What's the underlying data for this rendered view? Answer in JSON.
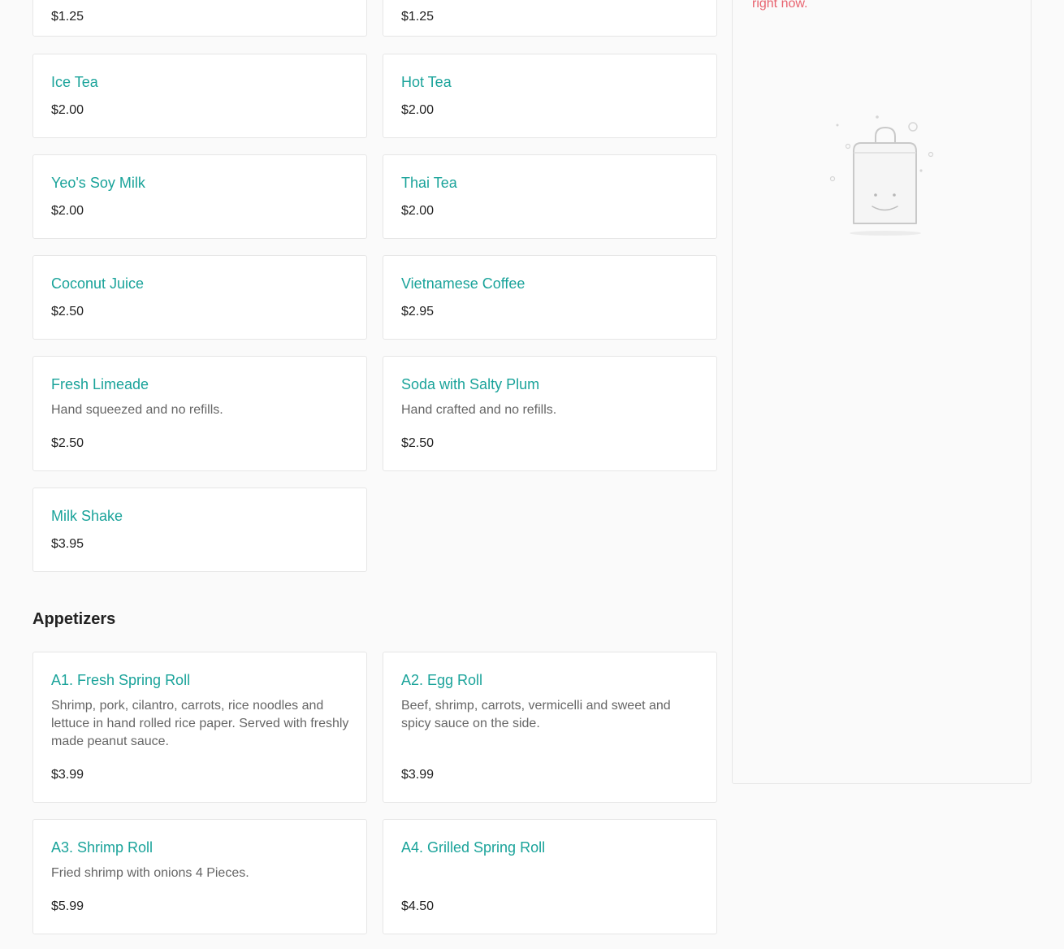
{
  "cart": {
    "empty_message": "right now."
  },
  "drinks": {
    "items": [
      {
        "price": "$1.25"
      },
      {
        "price": "$1.25"
      },
      {
        "name": "Ice Tea",
        "price": "$2.00"
      },
      {
        "name": "Hot Tea",
        "price": "$2.00"
      },
      {
        "name": "Yeo's Soy Milk",
        "price": "$2.00"
      },
      {
        "name": "Thai Tea",
        "price": "$2.00"
      },
      {
        "name": "Coconut Juice",
        "price": "$2.50"
      },
      {
        "name": "Vietnamese Coffee",
        "price": "$2.95"
      },
      {
        "name": "Fresh Limeade",
        "description": "Hand squeezed and no refills.",
        "price": "$2.50"
      },
      {
        "name": "Soda with Salty Plum",
        "description": "Hand crafted and no refills.",
        "price": "$2.50"
      },
      {
        "name": "Milk Shake",
        "price": "$3.95"
      }
    ]
  },
  "appetizers": {
    "title": "Appetizers",
    "items": [
      {
        "name": "A1. Fresh Spring Roll",
        "description": "Shrimp, pork, cilantro, carrots, rice noodles and lettuce in hand rolled rice paper. Served with freshly made peanut sauce.",
        "price": "$3.99"
      },
      {
        "name": "A2. Egg Roll",
        "description": "Beef, shrimp, carrots, vermicelli and sweet and spicy sauce on the side.",
        "price": "$3.99"
      },
      {
        "name": "A3. Shrimp Roll",
        "description": "Fried shrimp with onions 4 Pieces.",
        "price": "$5.99"
      },
      {
        "name": "A4. Grilled Spring Roll",
        "price": "$4.50"
      }
    ]
  },
  "colors": {
    "accent": "#1aa39a",
    "cart_message": "#e8636f",
    "card_border": "#e6e6e6",
    "background": "#fafafa"
  },
  "icons": {
    "empty_cart": "shopping-bag-smile-icon"
  }
}
